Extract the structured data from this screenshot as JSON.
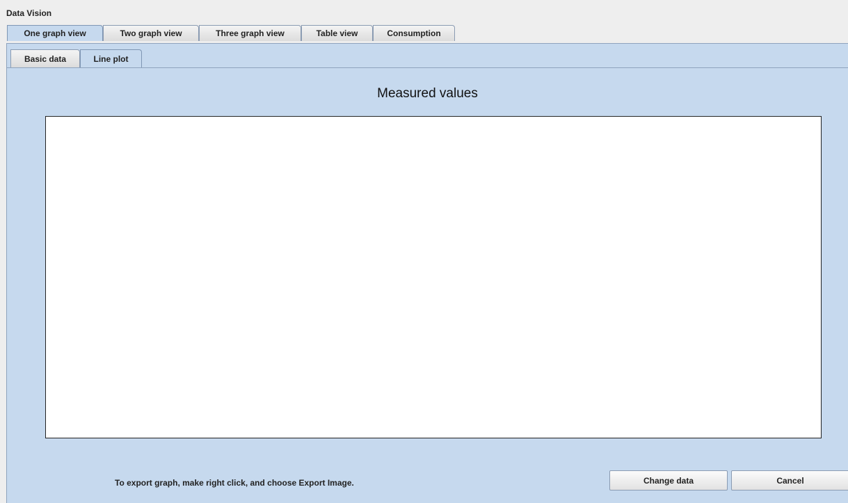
{
  "window": {
    "title": "Data Vision"
  },
  "main_tabs": [
    {
      "label": "One graph view",
      "active": true
    },
    {
      "label": "Two graph view",
      "active": false
    },
    {
      "label": "Three graph view",
      "active": false
    },
    {
      "label": "Table view",
      "active": false
    },
    {
      "label": "Consumption",
      "active": false
    }
  ],
  "sub_tabs": [
    {
      "label": "Basic data",
      "active": false
    },
    {
      "label": "Line plot",
      "active": true
    }
  ],
  "chart": {
    "title": "Measured values"
  },
  "footer": {
    "hint": "To export graph, make right click, and choose Export Image.",
    "change_data_label": "Change data",
    "cancel_label": "Cancel"
  },
  "colors": {
    "panel_background": "#c6d9ee",
    "plot_background": "#ffffff"
  }
}
